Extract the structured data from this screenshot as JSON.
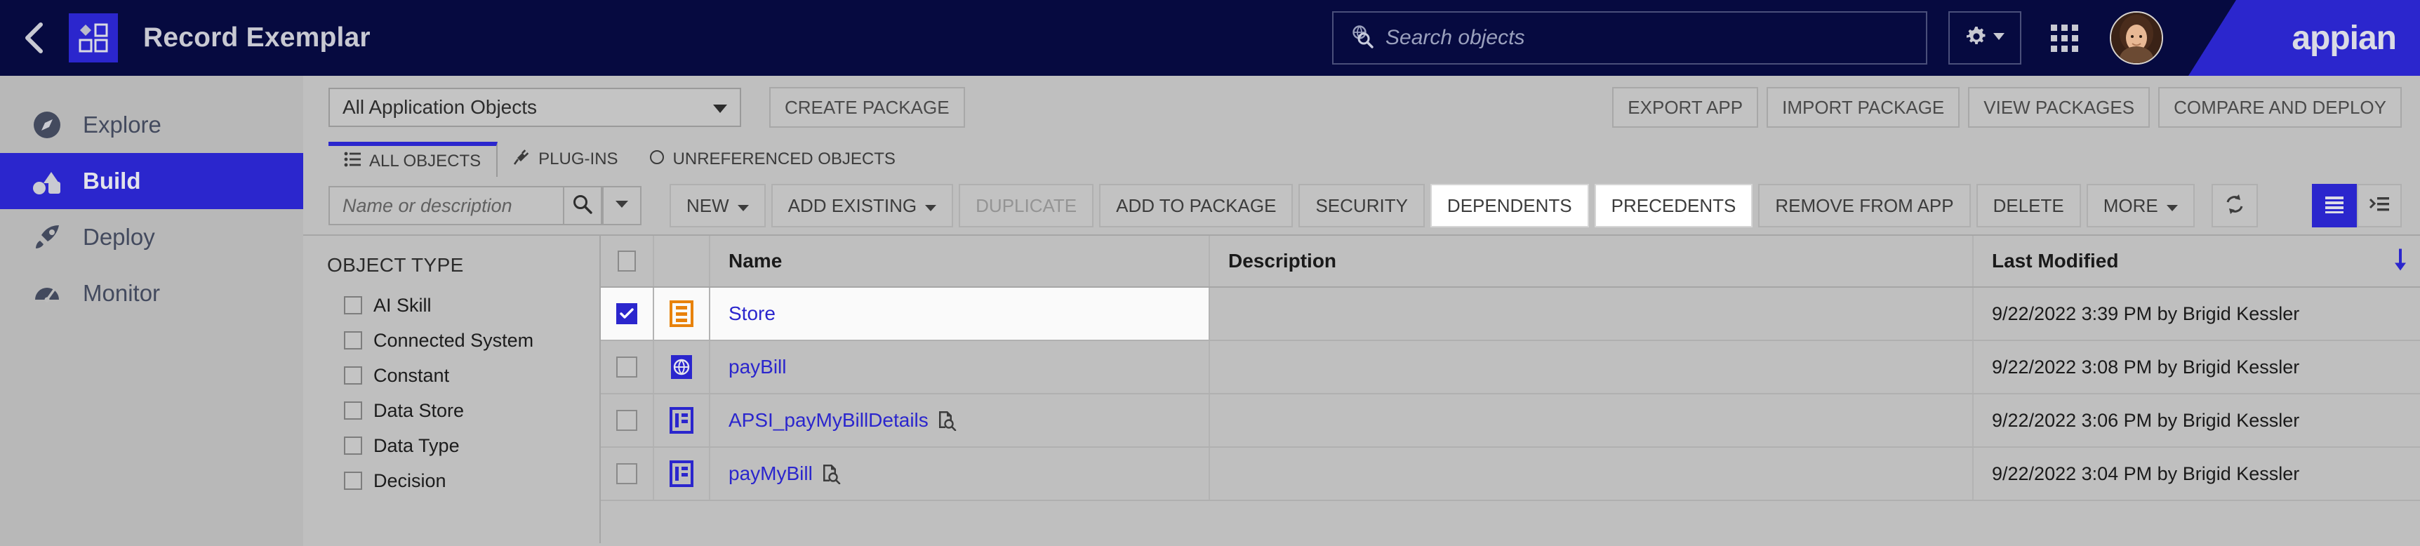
{
  "header": {
    "back_icon": "chevron-left-icon",
    "app_icon": "app-objects-icon",
    "title": "Record Exemplar",
    "search_placeholder": "Search objects",
    "search_icon": "globe-search-icon",
    "gear_icon": "gear-icon",
    "gear_caret_icon": "caret-down-icon",
    "apps_grid_icon": "apps-grid-icon",
    "avatar_label": "user-avatar",
    "brand": "appian",
    "brand_color": "#2b26cd",
    "bg_color": "#060a40"
  },
  "sidebar": {
    "items": [
      {
        "label": "Explore",
        "icon": "compass-icon",
        "active": false
      },
      {
        "label": "Build",
        "icon": "build-shapes-icon",
        "active": true
      },
      {
        "label": "Deploy",
        "icon": "rocket-icon",
        "active": false
      },
      {
        "label": "Monitor",
        "icon": "gauge-icon",
        "active": false
      }
    ]
  },
  "app_toolbar": {
    "scope_select": "All Application Objects",
    "scope_caret_icon": "caret-down-icon",
    "create_package": "CREATE PACKAGE",
    "right_buttons": [
      "EXPORT APP",
      "IMPORT PACKAGE",
      "VIEW PACKAGES",
      "COMPARE AND DEPLOY"
    ]
  },
  "tabs": [
    {
      "label": "ALL OBJECTS",
      "icon": "list-icon",
      "active": true
    },
    {
      "label": "PLUG-INS",
      "icon": "plug-icon",
      "active": false
    },
    {
      "label": "UNREFERENCED OBJECTS",
      "icon": "circle-icon",
      "active": false
    }
  ],
  "actions": {
    "search_placeholder": "Name or description",
    "search_icon": "search-icon",
    "search_caret_icon": "caret-down-icon",
    "buttons": [
      {
        "label": "NEW",
        "caret": true,
        "state": "normal"
      },
      {
        "label": "ADD EXISTING",
        "caret": true,
        "state": "normal"
      },
      {
        "label": "DUPLICATE",
        "caret": false,
        "state": "disabled"
      },
      {
        "label": "ADD TO PACKAGE",
        "caret": false,
        "state": "normal"
      },
      {
        "label": "SECURITY",
        "caret": false,
        "state": "normal"
      },
      {
        "label": "DEPENDENTS",
        "caret": false,
        "state": "highlighted"
      },
      {
        "label": "PRECEDENTS",
        "caret": false,
        "state": "highlighted"
      },
      {
        "label": "REMOVE FROM APP",
        "caret": false,
        "state": "normal"
      },
      {
        "label": "DELETE",
        "caret": false,
        "state": "normal"
      },
      {
        "label": "MORE",
        "caret": true,
        "state": "normal"
      }
    ],
    "refresh_icon": "refresh-icon",
    "view_list_icon": "view-list-icon",
    "view_detail_icon": "view-detail-icon",
    "view_active": "list"
  },
  "facets": {
    "title": "OBJECT TYPE",
    "options": [
      "AI Skill",
      "Connected System",
      "Constant",
      "Data Store",
      "Data Type",
      "Decision"
    ]
  },
  "table": {
    "columns": [
      "Name",
      "Description",
      "Last Modified"
    ],
    "sort_icon": "sort-desc-arrow-icon",
    "rows": [
      {
        "selected": true,
        "icon": "record-type-icon",
        "icon_color": "#e8820c",
        "name": "Store",
        "has_preview": false,
        "description": "",
        "last_modified": "9/22/2022 3:39 PM by Brigid Kessler"
      },
      {
        "selected": false,
        "icon": "web-api-icon",
        "icon_color": "#2b26cd",
        "name": "payBill",
        "has_preview": false,
        "description": "",
        "last_modified": "9/22/2022 3:08 PM by Brigid Kessler"
      },
      {
        "selected": false,
        "icon": "interface-icon",
        "icon_color": "#2b26cd",
        "name": "APSI_payMyBillDetails",
        "has_preview": true,
        "description": "",
        "last_modified": "9/22/2022 3:06 PM by Brigid Kessler"
      },
      {
        "selected": false,
        "icon": "interface-icon",
        "icon_color": "#2b26cd",
        "name": "payMyBill",
        "has_preview": true,
        "description": "",
        "last_modified": "9/22/2022 3:04 PM by Brigid Kessler"
      }
    ]
  }
}
